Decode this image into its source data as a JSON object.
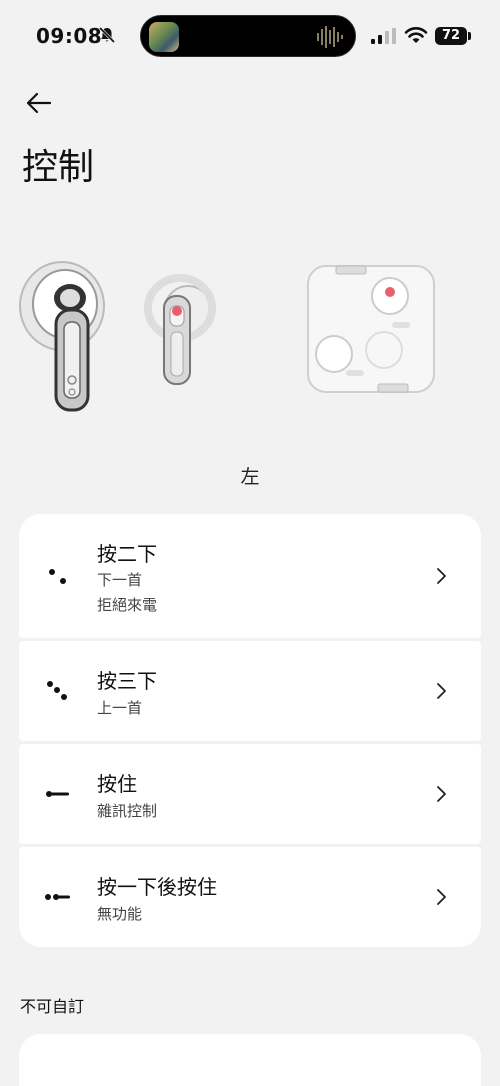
{
  "status": {
    "time": "09:08",
    "battery": "72"
  },
  "header": {
    "title": "控制"
  },
  "hero": {
    "side_label": "左"
  },
  "controls": [
    {
      "icon": "double-tap-dots-icon",
      "title": "按二下",
      "lines": [
        "下一首",
        "拒絕來電"
      ]
    },
    {
      "icon": "triple-tap-dots-icon",
      "title": "按三下",
      "lines": [
        "上一首"
      ]
    },
    {
      "icon": "press-hold-line-icon",
      "title": "按住",
      "lines": [
        "雜訊控制"
      ]
    },
    {
      "icon": "tap-and-hold-icon",
      "title": "按一下後按住",
      "lines": [
        "無功能"
      ]
    }
  ],
  "section": {
    "not_customizable": "不可自訂"
  }
}
